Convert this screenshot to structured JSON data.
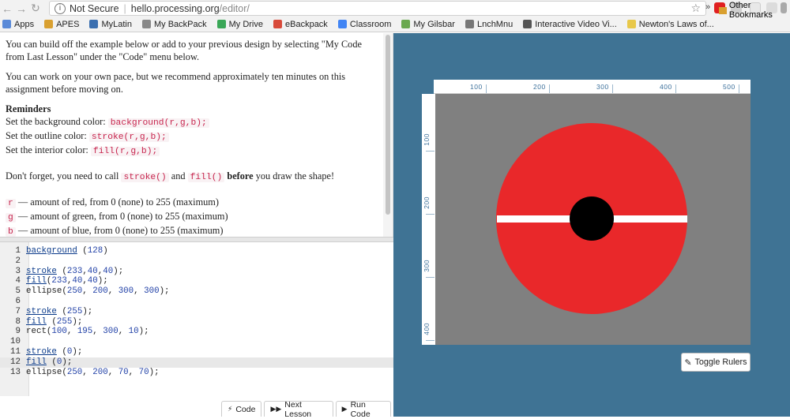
{
  "browser": {
    "not_secure": "Not Secure",
    "url_host": "hello.processing.org",
    "url_path": "/editor/",
    "back_icon": "arrow-left-icon",
    "forward_icon": "arrow-right-icon",
    "refresh_icon": "refresh-icon"
  },
  "bookmarks": {
    "items": [
      {
        "label": "Apps",
        "icon": "apps-grid-icon",
        "color": "#5a8ad8"
      },
      {
        "label": "APES",
        "icon": "folder-icon",
        "color": "#d9a030"
      },
      {
        "label": "MyLatin",
        "icon": "bookmark-i-icon",
        "color": "#3a6fb0"
      },
      {
        "label": "My BackPack",
        "icon": "backpack-icon",
        "color": "#888888"
      },
      {
        "label": "My Drive",
        "icon": "drive-icon",
        "color": "#3aa757"
      },
      {
        "label": "eBackpack",
        "icon": "ebackpack-icon",
        "color": "#d84a3a"
      },
      {
        "label": "Classroom",
        "icon": "google-g-icon",
        "color": "#4285f4"
      },
      {
        "label": "My Gilsbar",
        "icon": "gilsbar-icon",
        "color": "#6aa84f"
      },
      {
        "label": "LnchMnu",
        "icon": "page-icon",
        "color": "#777777"
      },
      {
        "label": "Interactive Video Vi...",
        "icon": "interactive-video-icon",
        "color": "#555555"
      },
      {
        "label": "Newton's Laws of...",
        "icon": "newton-page-icon",
        "color": "#e8c84a"
      }
    ],
    "more": "»",
    "other": "Other Bookmarks"
  },
  "instructions": {
    "p1": "You can build off the example below or add to your previous design by selecting \"My Code from Last Lesson\" under the \"Code\" menu below.",
    "p2": "You can work on your own pace, but we recommend approximately ten minutes on this assignment before moving on.",
    "reminders_heading": "Reminders",
    "bg_label": "Set the background color:",
    "bg_code": "background(r,g,b);",
    "outline_label": "Set the outline color:",
    "outline_code": "stroke(r,g,b);",
    "interior_label": "Set the interior color:",
    "interior_code": "fill(r,g,b);",
    "forget_pre": "Don't forget, you need to call",
    "forget_stroke": "stroke()",
    "forget_and": "and",
    "forget_fill": "fill()",
    "forget_before": "before",
    "forget_post": "you draw the shape!",
    "r_code": "r",
    "r_desc": "— amount of red, from 0 (none) to 255 (maximum)",
    "g_code": "g",
    "g_desc": "— amount of green, from 0 (none) to 255 (maximum)",
    "b_code": "b",
    "b_desc": "— amount of blue, from 0 (none) to 255 (maximum)"
  },
  "editor": {
    "lines": [
      {
        "n": "1",
        "fn": "background",
        "rest": " (128)"
      },
      {
        "n": "2",
        "fn": "",
        "rest": ""
      },
      {
        "n": "3",
        "fn": "stroke",
        "rest": " (233,40,40);"
      },
      {
        "n": "4",
        "fn": "fill",
        "rest": "(233,40,40);"
      },
      {
        "n": "5",
        "fn": "",
        "rest": "ellipse(250, 200, 300, 300);"
      },
      {
        "n": "6",
        "fn": "",
        "rest": ""
      },
      {
        "n": "7",
        "fn": "stroke",
        "rest": " (255);"
      },
      {
        "n": "8",
        "fn": "fill",
        "rest": " (255);"
      },
      {
        "n": "9",
        "fn": "",
        "rest": "rect(100, 195, 300, 10);"
      },
      {
        "n": "10",
        "fn": "",
        "rest": ""
      },
      {
        "n": "11",
        "fn": "stroke",
        "rest": " (0);"
      },
      {
        "n": "12",
        "fn": "fill",
        "rest": " (0);"
      },
      {
        "n": "13",
        "fn": "",
        "rest": "ellipse(250, 200, 70, 70);"
      }
    ],
    "active_line": "12",
    "buttons": {
      "code": "Code",
      "next": "Next Lesson",
      "run": "Run Code"
    }
  },
  "preview": {
    "ruler_top": [
      "100",
      "200",
      "300",
      "400",
      "500"
    ],
    "ruler_left": [
      "100",
      "200",
      "300",
      "400"
    ],
    "toggle_rulers": "Toggle Rulers",
    "canvas": {
      "background": "#808080",
      "circle_color": "#e9282a",
      "stripe_color": "#ffffff",
      "center_color": "#000000"
    }
  }
}
